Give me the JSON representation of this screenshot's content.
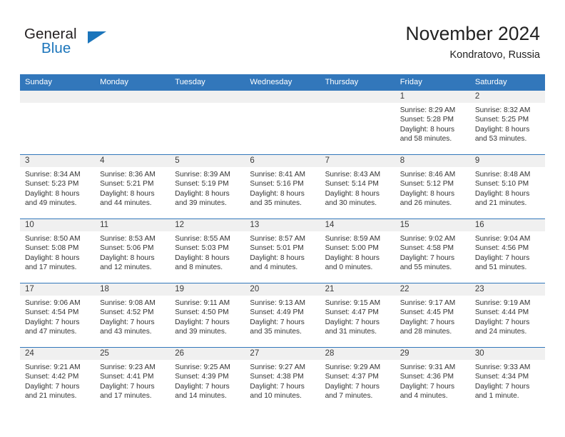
{
  "logo": {
    "word_one": "General",
    "word_two": "Blue",
    "triangle_icon": "triangle-icon"
  },
  "header": {
    "title": "November 2024",
    "subtitle": "Kondratovo, Russia"
  },
  "colors": {
    "header_blue": "#3277bb",
    "logo_blue": "#1b75bb",
    "daynum_band": "#f0f0f0",
    "text": "#333333"
  },
  "calendar": {
    "weekdays": [
      "Sunday",
      "Monday",
      "Tuesday",
      "Wednesday",
      "Thursday",
      "Friday",
      "Saturday"
    ],
    "weeks": [
      [
        {
          "day": "",
          "sunrise": "",
          "sunset": "",
          "daylight_line1": "",
          "daylight_line2": ""
        },
        {
          "day": "",
          "sunrise": "",
          "sunset": "",
          "daylight_line1": "",
          "daylight_line2": ""
        },
        {
          "day": "",
          "sunrise": "",
          "sunset": "",
          "daylight_line1": "",
          "daylight_line2": ""
        },
        {
          "day": "",
          "sunrise": "",
          "sunset": "",
          "daylight_line1": "",
          "daylight_line2": ""
        },
        {
          "day": "",
          "sunrise": "",
          "sunset": "",
          "daylight_line1": "",
          "daylight_line2": ""
        },
        {
          "day": "1",
          "sunrise": "Sunrise: 8:29 AM",
          "sunset": "Sunset: 5:28 PM",
          "daylight_line1": "Daylight: 8 hours",
          "daylight_line2": "and 58 minutes."
        },
        {
          "day": "2",
          "sunrise": "Sunrise: 8:32 AM",
          "sunset": "Sunset: 5:25 PM",
          "daylight_line1": "Daylight: 8 hours",
          "daylight_line2": "and 53 minutes."
        }
      ],
      [
        {
          "day": "3",
          "sunrise": "Sunrise: 8:34 AM",
          "sunset": "Sunset: 5:23 PM",
          "daylight_line1": "Daylight: 8 hours",
          "daylight_line2": "and 49 minutes."
        },
        {
          "day": "4",
          "sunrise": "Sunrise: 8:36 AM",
          "sunset": "Sunset: 5:21 PM",
          "daylight_line1": "Daylight: 8 hours",
          "daylight_line2": "and 44 minutes."
        },
        {
          "day": "5",
          "sunrise": "Sunrise: 8:39 AM",
          "sunset": "Sunset: 5:19 PM",
          "daylight_line1": "Daylight: 8 hours",
          "daylight_line2": "and 39 minutes."
        },
        {
          "day": "6",
          "sunrise": "Sunrise: 8:41 AM",
          "sunset": "Sunset: 5:16 PM",
          "daylight_line1": "Daylight: 8 hours",
          "daylight_line2": "and 35 minutes."
        },
        {
          "day": "7",
          "sunrise": "Sunrise: 8:43 AM",
          "sunset": "Sunset: 5:14 PM",
          "daylight_line1": "Daylight: 8 hours",
          "daylight_line2": "and 30 minutes."
        },
        {
          "day": "8",
          "sunrise": "Sunrise: 8:46 AM",
          "sunset": "Sunset: 5:12 PM",
          "daylight_line1": "Daylight: 8 hours",
          "daylight_line2": "and 26 minutes."
        },
        {
          "day": "9",
          "sunrise": "Sunrise: 8:48 AM",
          "sunset": "Sunset: 5:10 PM",
          "daylight_line1": "Daylight: 8 hours",
          "daylight_line2": "and 21 minutes."
        }
      ],
      [
        {
          "day": "10",
          "sunrise": "Sunrise: 8:50 AM",
          "sunset": "Sunset: 5:08 PM",
          "daylight_line1": "Daylight: 8 hours",
          "daylight_line2": "and 17 minutes."
        },
        {
          "day": "11",
          "sunrise": "Sunrise: 8:53 AM",
          "sunset": "Sunset: 5:06 PM",
          "daylight_line1": "Daylight: 8 hours",
          "daylight_line2": "and 12 minutes."
        },
        {
          "day": "12",
          "sunrise": "Sunrise: 8:55 AM",
          "sunset": "Sunset: 5:03 PM",
          "daylight_line1": "Daylight: 8 hours",
          "daylight_line2": "and 8 minutes."
        },
        {
          "day": "13",
          "sunrise": "Sunrise: 8:57 AM",
          "sunset": "Sunset: 5:01 PM",
          "daylight_line1": "Daylight: 8 hours",
          "daylight_line2": "and 4 minutes."
        },
        {
          "day": "14",
          "sunrise": "Sunrise: 8:59 AM",
          "sunset": "Sunset: 5:00 PM",
          "daylight_line1": "Daylight: 8 hours",
          "daylight_line2": "and 0 minutes."
        },
        {
          "day": "15",
          "sunrise": "Sunrise: 9:02 AM",
          "sunset": "Sunset: 4:58 PM",
          "daylight_line1": "Daylight: 7 hours",
          "daylight_line2": "and 55 minutes."
        },
        {
          "day": "16",
          "sunrise": "Sunrise: 9:04 AM",
          "sunset": "Sunset: 4:56 PM",
          "daylight_line1": "Daylight: 7 hours",
          "daylight_line2": "and 51 minutes."
        }
      ],
      [
        {
          "day": "17",
          "sunrise": "Sunrise: 9:06 AM",
          "sunset": "Sunset: 4:54 PM",
          "daylight_line1": "Daylight: 7 hours",
          "daylight_line2": "and 47 minutes."
        },
        {
          "day": "18",
          "sunrise": "Sunrise: 9:08 AM",
          "sunset": "Sunset: 4:52 PM",
          "daylight_line1": "Daylight: 7 hours",
          "daylight_line2": "and 43 minutes."
        },
        {
          "day": "19",
          "sunrise": "Sunrise: 9:11 AM",
          "sunset": "Sunset: 4:50 PM",
          "daylight_line1": "Daylight: 7 hours",
          "daylight_line2": "and 39 minutes."
        },
        {
          "day": "20",
          "sunrise": "Sunrise: 9:13 AM",
          "sunset": "Sunset: 4:49 PM",
          "daylight_line1": "Daylight: 7 hours",
          "daylight_line2": "and 35 minutes."
        },
        {
          "day": "21",
          "sunrise": "Sunrise: 9:15 AM",
          "sunset": "Sunset: 4:47 PM",
          "daylight_line1": "Daylight: 7 hours",
          "daylight_line2": "and 31 minutes."
        },
        {
          "day": "22",
          "sunrise": "Sunrise: 9:17 AM",
          "sunset": "Sunset: 4:45 PM",
          "daylight_line1": "Daylight: 7 hours",
          "daylight_line2": "and 28 minutes."
        },
        {
          "day": "23",
          "sunrise": "Sunrise: 9:19 AM",
          "sunset": "Sunset: 4:44 PM",
          "daylight_line1": "Daylight: 7 hours",
          "daylight_line2": "and 24 minutes."
        }
      ],
      [
        {
          "day": "24",
          "sunrise": "Sunrise: 9:21 AM",
          "sunset": "Sunset: 4:42 PM",
          "daylight_line1": "Daylight: 7 hours",
          "daylight_line2": "and 21 minutes."
        },
        {
          "day": "25",
          "sunrise": "Sunrise: 9:23 AM",
          "sunset": "Sunset: 4:41 PM",
          "daylight_line1": "Daylight: 7 hours",
          "daylight_line2": "and 17 minutes."
        },
        {
          "day": "26",
          "sunrise": "Sunrise: 9:25 AM",
          "sunset": "Sunset: 4:39 PM",
          "daylight_line1": "Daylight: 7 hours",
          "daylight_line2": "and 14 minutes."
        },
        {
          "day": "27",
          "sunrise": "Sunrise: 9:27 AM",
          "sunset": "Sunset: 4:38 PM",
          "daylight_line1": "Daylight: 7 hours",
          "daylight_line2": "and 10 minutes."
        },
        {
          "day": "28",
          "sunrise": "Sunrise: 9:29 AM",
          "sunset": "Sunset: 4:37 PM",
          "daylight_line1": "Daylight: 7 hours",
          "daylight_line2": "and 7 minutes."
        },
        {
          "day": "29",
          "sunrise": "Sunrise: 9:31 AM",
          "sunset": "Sunset: 4:36 PM",
          "daylight_line1": "Daylight: 7 hours",
          "daylight_line2": "and 4 minutes."
        },
        {
          "day": "30",
          "sunrise": "Sunrise: 9:33 AM",
          "sunset": "Sunset: 4:34 PM",
          "daylight_line1": "Daylight: 7 hours",
          "daylight_line2": "and 1 minute."
        }
      ]
    ]
  }
}
